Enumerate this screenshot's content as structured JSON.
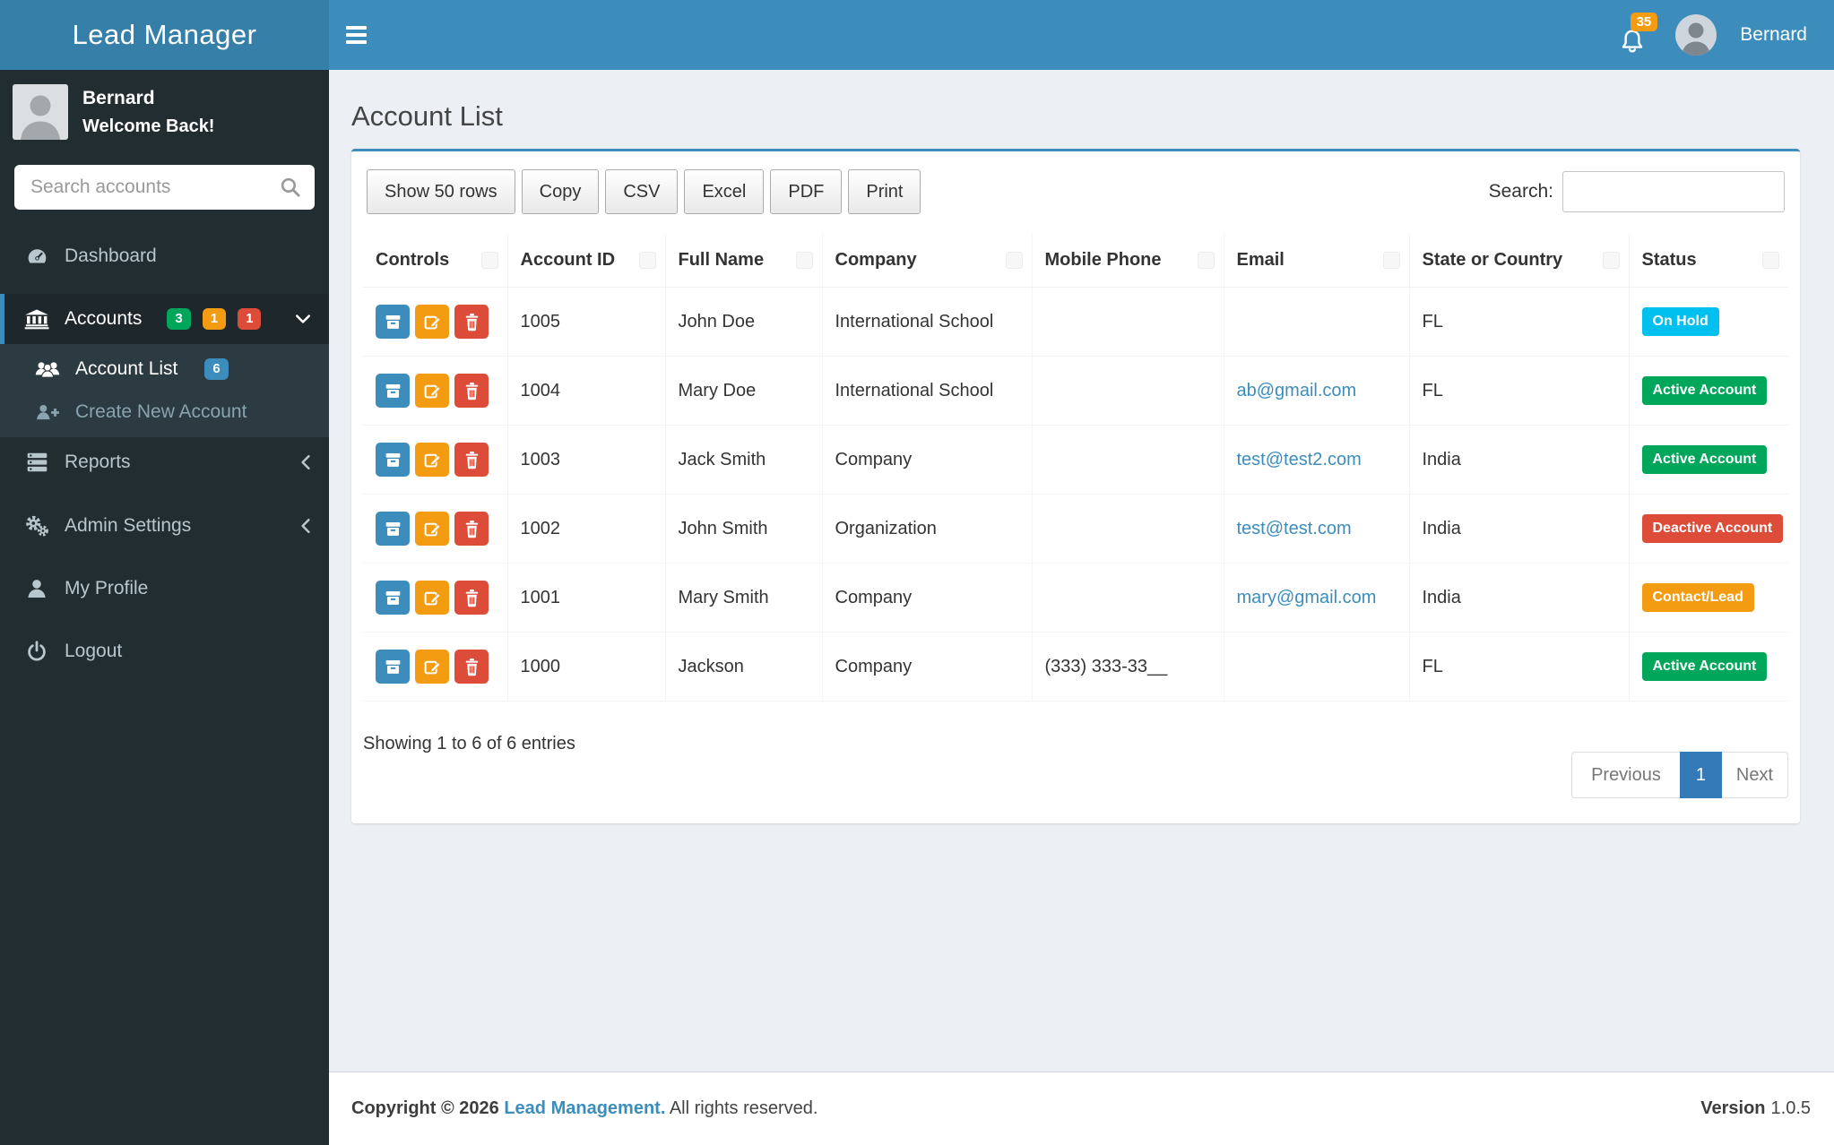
{
  "colors": {
    "navbar": "#3c8dbc",
    "logo_bg": "#367fa9",
    "sidebar_bg": "#222d32",
    "submenu_bg": "#2c3b41",
    "accent": "#3c8dbc",
    "badge_green": "#00a65a",
    "badge_yellow": "#f39c12",
    "badge_red": "#dd4b39",
    "badge_blue": "#3c8dbc",
    "pagination_active": "#337ab7"
  },
  "topbar": {
    "brand": "Lead Manager",
    "notification_count": "35",
    "user_name": "Bernard"
  },
  "sidebar": {
    "user_name": "Bernard",
    "user_greeting": "Welcome Back!",
    "search_placeholder": "Search accounts",
    "dashboard": "Dashboard",
    "accounts": "Accounts",
    "accounts_badges": [
      {
        "text": "3",
        "color": "#00a65a"
      },
      {
        "text": "1",
        "color": "#f39c12"
      },
      {
        "text": "1",
        "color": "#dd4b39"
      }
    ],
    "account_list": "Account List",
    "account_list_badge": "6",
    "create_new_account": "Create New Account",
    "reports": "Reports",
    "admin_settings": "Admin Settings",
    "my_profile": "My Profile",
    "logout": "Logout"
  },
  "page": {
    "title": "Account List"
  },
  "toolbar": {
    "show_rows": "Show 50 rows",
    "copy": "Copy",
    "csv": "CSV",
    "excel": "Excel",
    "pdf": "PDF",
    "print": "Print",
    "search_label": "Search:",
    "search_value": ""
  },
  "table": {
    "columns": [
      "Controls",
      "Account ID",
      "Full Name",
      "Company",
      "Mobile Phone",
      "Email",
      "State or Country",
      "Status"
    ],
    "rows": [
      {
        "id": "1005",
        "full_name": "John Doe",
        "company": "International School",
        "mobile": "",
        "email": "",
        "state": "FL",
        "status": "On Hold",
        "status_color": "#00c0ef"
      },
      {
        "id": "1004",
        "full_name": "Mary Doe",
        "company": "International School",
        "mobile": "",
        "email": "ab@gmail.com",
        "state": "FL",
        "status": "Active Account",
        "status_color": "#00a65a"
      },
      {
        "id": "1003",
        "full_name": "Jack Smith",
        "company": "Company",
        "mobile": "",
        "email": "test@test2.com",
        "state": "India",
        "status": "Active Account",
        "status_color": "#00a65a"
      },
      {
        "id": "1002",
        "full_name": "John Smith",
        "company": "Organization",
        "mobile": "",
        "email": "test@test.com",
        "state": "India",
        "status": "Deactive Account",
        "status_color": "#dd4b39"
      },
      {
        "id": "1001",
        "full_name": "Mary Smith",
        "company": "Company",
        "mobile": "",
        "email": "mary@gmail.com",
        "state": "India",
        "status": "Contact/Lead",
        "status_color": "#f39c12"
      },
      {
        "id": "1000",
        "full_name": "Jackson",
        "company": "Company",
        "mobile": "(333) 333-33__",
        "email": "",
        "state": "FL",
        "status": "Active Account",
        "status_color": "#00a65a"
      }
    ]
  },
  "pagination": {
    "info": "Showing 1 to 6 of 6 entries",
    "previous": "Previous",
    "current_page": "1",
    "next": "Next"
  },
  "footer": {
    "copyright": "Copyright © 2026",
    "brand": "Lead Management.",
    "rights": "All rights reserved.",
    "version_label": "Version",
    "version_value": "1.0.5"
  }
}
